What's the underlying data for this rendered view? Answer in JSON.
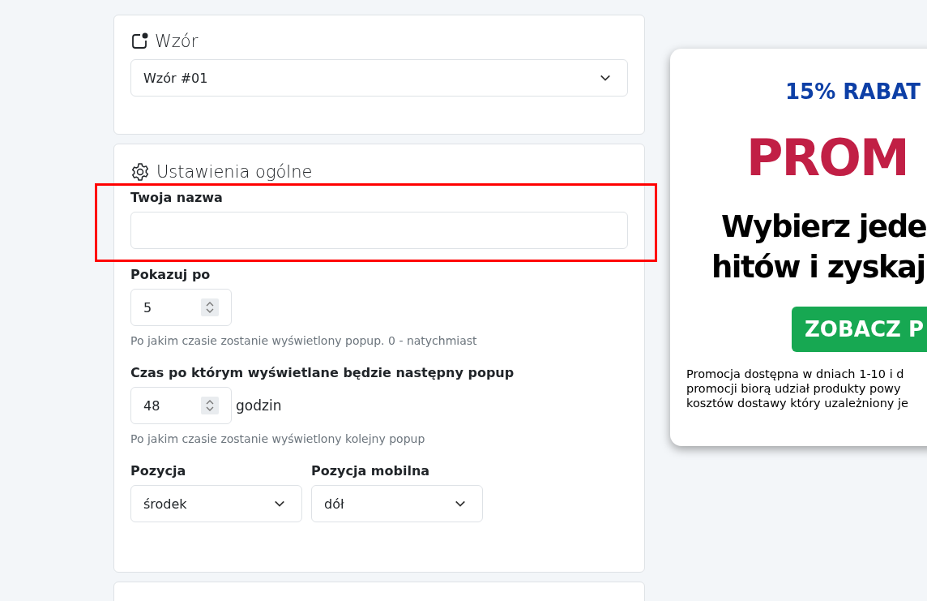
{
  "template_card": {
    "title": "Wzór",
    "select": {
      "value": "Wzór #01"
    }
  },
  "general_card": {
    "title": "Ustawienia ogólne",
    "fields": [
      {
        "kind": "text",
        "label": "Twoja nazwa",
        "highlighted": true
      },
      {
        "kind": "number",
        "label": "Pokazuj po",
        "value": "5",
        "help": "Po jakim czasie zostanie wyświetlony popup. 0 - natychmiast"
      },
      {
        "kind": "number",
        "label": "Czas po którym wyświetlane będzie następny popup",
        "value": "48",
        "unit": "godzin",
        "help": "Po jakim czasie zostanie wyświetlony kolejny popup"
      }
    ],
    "selects": [
      {
        "label": "Pozycja",
        "value": "środek"
      },
      {
        "label": "Pozycja mobilna",
        "value": "dół"
      }
    ]
  },
  "preview": {
    "discount": "15% RABAT",
    "headline": "PROM",
    "subtitle_lines": [
      "Wybierz jede",
      "hitów i zyskaj"
    ],
    "button": "ZOBACZ P",
    "note_lines": [
      "Promocja dostępna w dniach 1-10 i d",
      "promocji biorą udział produkty powy",
      "kosztów dostawy który uzależniony je"
    ]
  }
}
